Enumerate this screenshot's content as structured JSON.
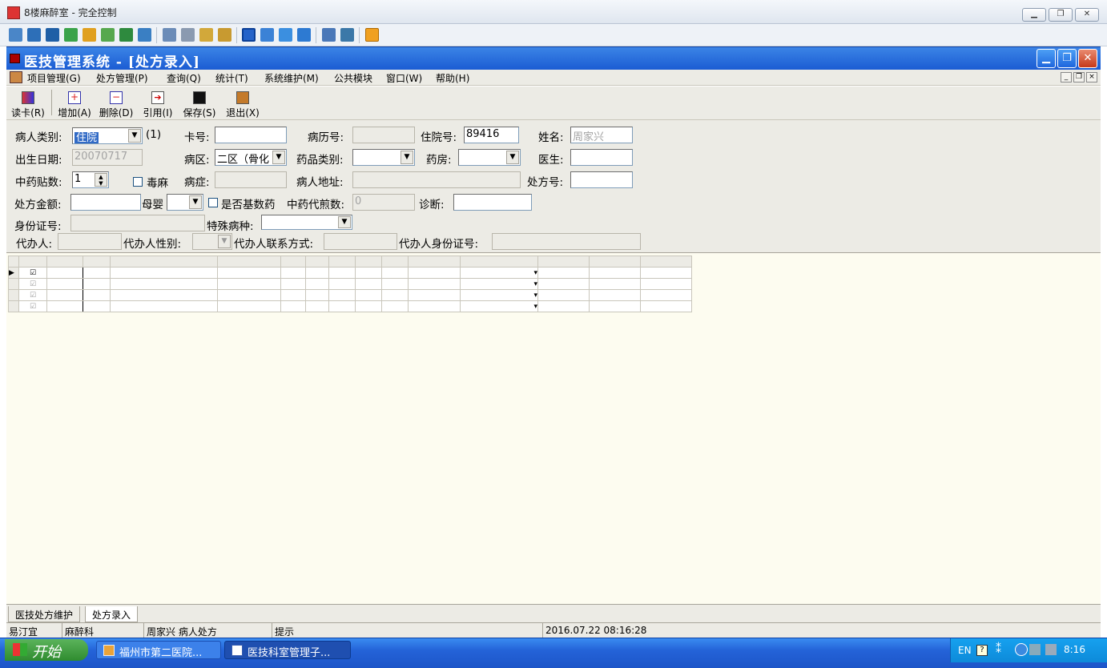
{
  "outer_window": {
    "title": "8楼麻醉室 - 完全控制"
  },
  "app": {
    "title": "医技管理系统 - [处方录入]",
    "menu": [
      "项目管理(G)",
      "处方管理(P)",
      "查询(Q)",
      "统计(T)",
      "系统维护(M)",
      "公共模块",
      "窗口(W)",
      "帮助(H)"
    ],
    "toolbar": [
      "读卡(R)",
      "增加(A)",
      "删除(D)",
      "引用(I)",
      "保存(S)",
      "退出(X)"
    ]
  },
  "form": {
    "patient_type_label": "病人类别:",
    "patient_type_value": "住院",
    "patient_type_suffix": "(1)",
    "card_no_label": "卡号:",
    "card_no_value": "",
    "record_no_label": "病历号:",
    "record_no_value": "",
    "admission_no_label": "住院号:",
    "admission_no_value": "89416",
    "name_label": "姓名:",
    "name_value": "周家兴",
    "birth_label": "出生日期:",
    "birth_value": "20070717",
    "ward_label": "病区:",
    "ward_value": "二区（骨化",
    "drug_type_label": "药品类别:",
    "drug_type_value": "",
    "pharmacy_label": "药房:",
    "pharmacy_value": "",
    "doctor_label": "医生:",
    "doctor_value": "",
    "tcm_doses_label": "中药贴数:",
    "tcm_doses_value": "1",
    "narcotic_label": "毒麻",
    "disease_label": "病症:",
    "disease_value": "",
    "address_label": "病人地址:",
    "address_value": "",
    "rx_no_label": "处方号:",
    "rx_no_value": "",
    "rx_amount_label": "处方金额:",
    "rx_amount_value": "",
    "mother_baby_label": "母婴",
    "basic_drug_label": "是否基数药",
    "decoction_label": "中药代煎数:",
    "decoction_value": "0",
    "diagnosis_label": "诊断:",
    "diagnosis_value": "",
    "id_label": "身份证号:",
    "id_value": "",
    "special_label": "特殊病种:",
    "special_value": "",
    "agent_label": "代办人:",
    "agent_value": "",
    "agent_gender_label": "代办人性别:",
    "agent_contact_label": "代办人联系方式:",
    "agent_contact_value": "",
    "agent_id_label": "代办人身份证号:",
    "agent_id_value": ""
  },
  "grid": {
    "rows": 4,
    "first_row_checked": true
  },
  "tabs": [
    "医技处方维护",
    "处方录入"
  ],
  "status": [
    "易汀宜",
    "麻醉科",
    "周家兴 病人处方",
    "提示",
    "2016.07.22 08:16:28"
  ],
  "taskbar": {
    "start": "开始",
    "tasks": [
      "福州市第二医院...",
      "医技科室管理子..."
    ],
    "lang": "EN",
    "clock": "8:16"
  }
}
